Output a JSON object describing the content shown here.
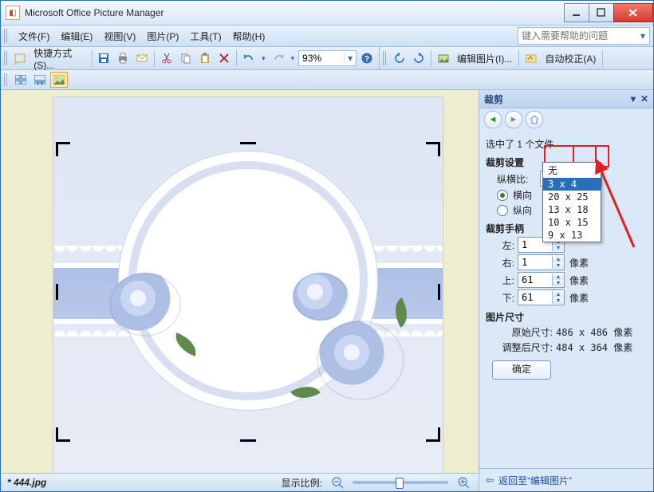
{
  "app": {
    "title": "Microsoft Office Picture Manager"
  },
  "menu": {
    "file": "文件(F)",
    "edit": "编辑(E)",
    "view": "视图(V)",
    "picture": "图片(P)",
    "tools": "工具(T)",
    "help": "帮助(H)",
    "help_placeholder": "键入需要帮助的问题"
  },
  "toolbar": {
    "shortcut": "快捷方式(S)...",
    "zoom_value": "93%",
    "edit_pictures": "编辑图片(I)...",
    "auto_correct": "自动校正(A)"
  },
  "taskpane": {
    "title": "裁剪",
    "selected": "选中了 1 个文件",
    "crop_settings": "裁剪设置",
    "aspect_label": "纵横比:",
    "aspect_value": "3 x 4",
    "aspect_options": [
      "无",
      "3 x 4",
      "20 x 25",
      "13 x 18",
      "10 x 15",
      "9 x 13"
    ],
    "orientation_h": "横向",
    "orientation_v": "纵向",
    "crop_handles": "裁剪手柄",
    "left_label": "左:",
    "left_value": "1",
    "right_label": "右:",
    "right_value": "1",
    "top_label": "上:",
    "top_value": "61",
    "bottom_label": "下:",
    "bottom_value": "61",
    "pixel_unit": "像素",
    "picture_size": "图片尺寸",
    "original_label": "原始尺寸:",
    "original_value": "486 x 486 像素",
    "resized_label": "调整后尺寸:",
    "resized_value": "484 x 364 像素",
    "ok": "确定",
    "back_link": "返回至“编辑图片”"
  },
  "status": {
    "filename": "* 444.jpg",
    "zoom_label": "显示比例:"
  }
}
